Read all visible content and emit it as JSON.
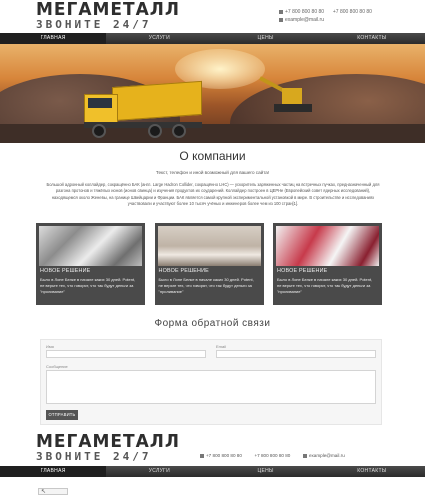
{
  "brand": {
    "name": "МЕГАМЕТАЛЛ",
    "tagline": "ЗВОНИТЕ 24/7"
  },
  "header": {
    "phone1": "+7 800 800 80 80",
    "phone2": "+7 800 800 80 80",
    "email": "example@mail.ru"
  },
  "nav": {
    "items": [
      {
        "label": "ГЛАВНАЯ",
        "active": true
      },
      {
        "label": "УСЛУГИ",
        "active": false
      },
      {
        "label": "ЦЕНЫ",
        "active": false
      },
      {
        "label": "КОНТАКТЫ",
        "active": false
      }
    ]
  },
  "about": {
    "title": "О компании",
    "lead": "Текст, телефон и иной возможный для вашего сайта!",
    "text": "Большой адронный коллайдер, сокращённо БАК (англ. Large Hadron Collider, сокращённо LHC) — ускоритель заряженных частиц на встречных пучках, предназначенный для разгона протонов и тяжёлых ионов (ионов свинца) и изучения продуктов их соударений. Коллайдер построен в ЦЕРНе (Европейский совет ядерных исследований), находящемся около Женевы, на границе Швейцарии и Франции. БАК является самой крупной экспериментальной установкой в мире. В строительстве и исследованиях участвовали и участвуют более 10 тысяч учёных и инженеров более чем из 100 стран[1]."
  },
  "cards": [
    {
      "title": "НОВОЕ РЕШЕНИЕ",
      "text": "Было в Лоне Белке в начале каких 30 дней. Potent, не верьте тех, что говорят, что так будут деньги за \"проливание\""
    },
    {
      "title": "НОВОЕ РЕШЕНИЕ",
      "text": "Было в Лоне Белке в начале каких 30 дней. Potent, не верьте тех, что говорят, что так будут деньги за \"проливание\""
    },
    {
      "title": "НОВОЕ РЕШЕНИЕ",
      "text": "Было в Лоне Белке в начале каких 30 дней. Potent, не верьте тех, что говорят, что так будут деньги за \"проливание\""
    }
  ],
  "form": {
    "title": "Форма обратной связи",
    "name_label": "Имя",
    "email_label": "Email",
    "message_label": "Сообщение",
    "submit_label": "ОТПРАВИТЬ"
  },
  "footer": {
    "phone1": "+7 800 800 80 80",
    "phone2": "+7 800 800 80 80",
    "email": "example@mail.ru"
  },
  "colors": {
    "nav_bg": "#3a3a3a",
    "card_bg": "#4a4a4a",
    "accent_truck": "#e6b21c"
  },
  "icons": [
    "phone-icon",
    "email-icon",
    "arrow-up-icon"
  ]
}
